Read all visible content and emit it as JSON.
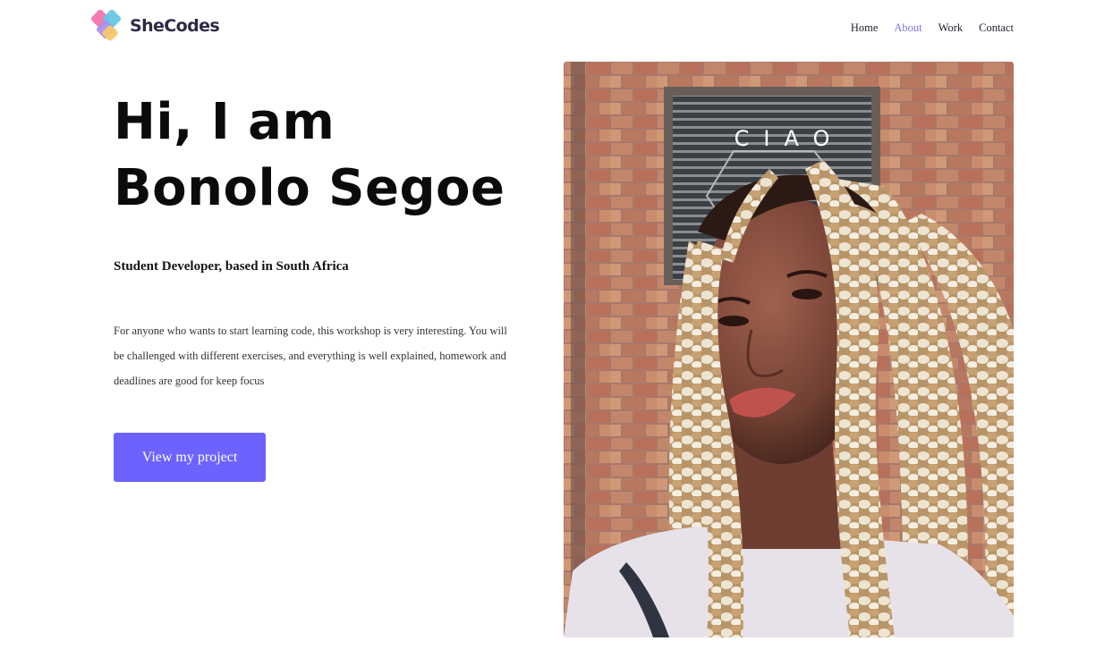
{
  "brand": {
    "name": "SheCodes",
    "logo_icon": "diamond-tiles-logo"
  },
  "nav": {
    "items": [
      {
        "label": "Home",
        "active": false
      },
      {
        "label": "About",
        "active": true
      },
      {
        "label": "Work",
        "active": false
      },
      {
        "label": "Contact",
        "active": false
      }
    ]
  },
  "hero": {
    "title_line1": "Hi, I am",
    "title_line2": "Bonolo Segoe",
    "subtitle": "Student Developer, based in South Africa",
    "description": "For anyone who wants to start learning code, this workshop is very interesting. You will be challenged with different exercises, and everything is well explained, homework and deadlines are good for keep focus",
    "cta_label": "View my project"
  },
  "photo": {
    "sign_text": "CIAO"
  },
  "colors": {
    "accent": "#6c63ff",
    "nav_active": "#7b73e4",
    "text": "#111111",
    "background": "#ffffff"
  }
}
